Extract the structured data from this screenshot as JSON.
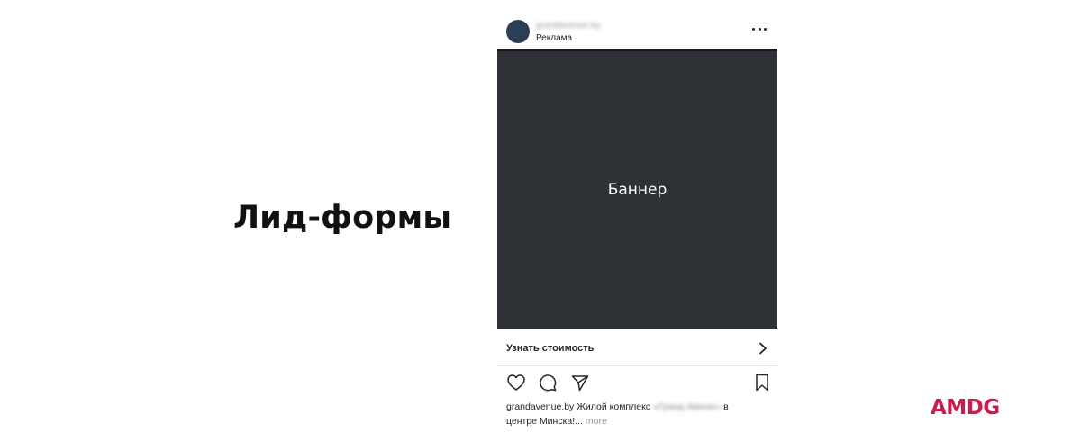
{
  "slide": {
    "title": "Лид-формы"
  },
  "post": {
    "account_name": "grandavenue.by",
    "sponsored_label": "Реклама",
    "banner_text": "Баннер",
    "cta_label": "Узнать стоимость",
    "caption": {
      "account": "grandavenue.by",
      "text_before": "Жилой комплекс",
      "blurred_name": "«Гранд Авеню»",
      "text_after": "в",
      "line2": "центре Минска!...",
      "more": "more"
    },
    "icons": [
      "more-dots-icon",
      "chevron-right-icon",
      "heart-icon",
      "comment-icon",
      "share-icon",
      "bookmark-icon"
    ]
  },
  "brand": {
    "logo_text": "AMDG",
    "accent_color": "#c81e4b"
  },
  "colors": {
    "avatar": "#2c3e55",
    "banner_background": "#2e3136"
  }
}
